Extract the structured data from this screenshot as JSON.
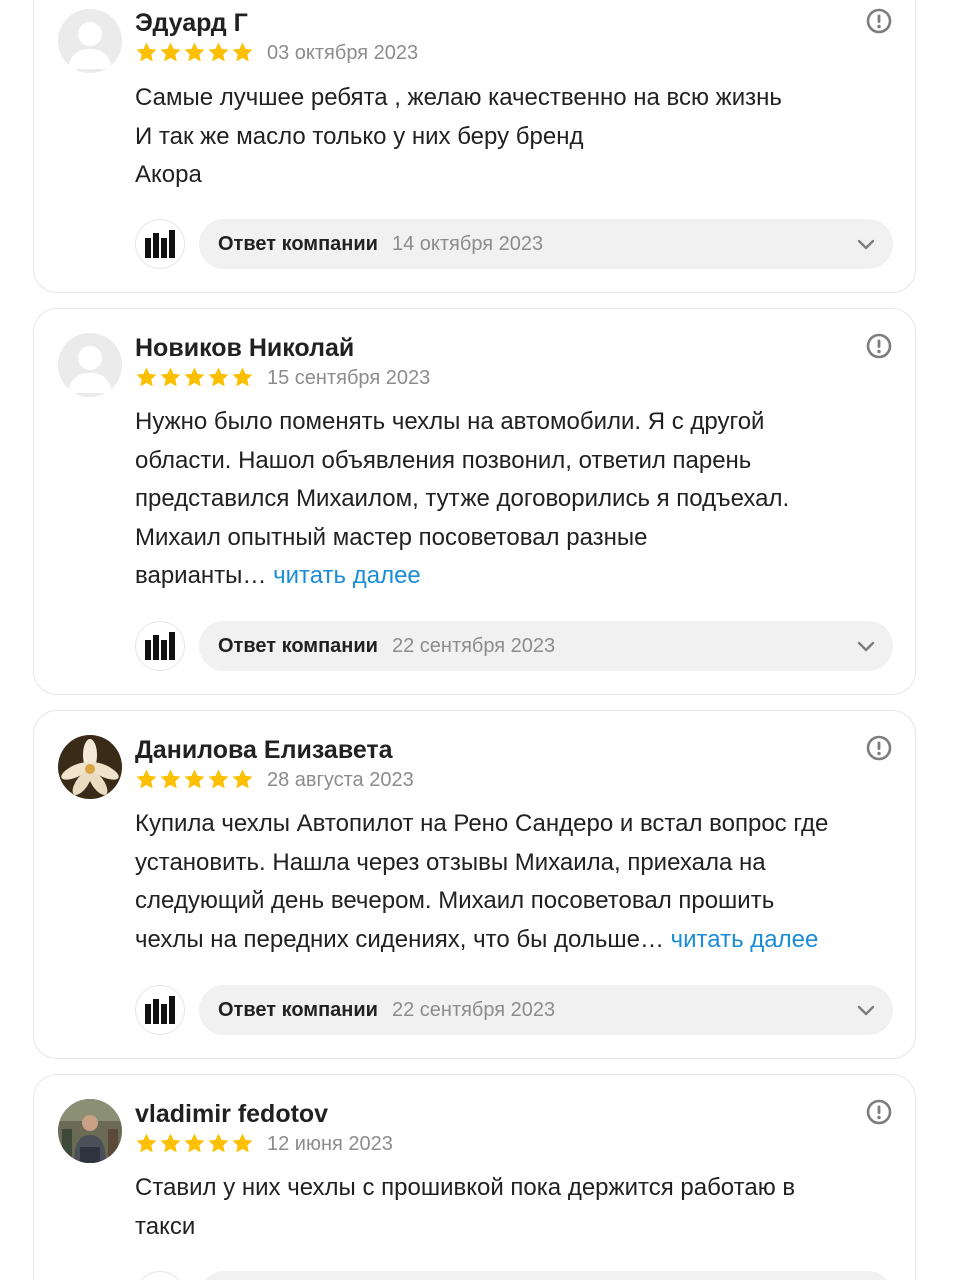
{
  "colors": {
    "star": "#fcc000",
    "link": "#1a8cd8",
    "muted": "#8c8c8c",
    "reply_bg": "#f1f1f1",
    "text": "#212121"
  },
  "icons": {
    "alert": "exclamation-circle-icon",
    "expand": "chevron-down-icon",
    "company": "company-logo-icon",
    "star": "star-icon"
  },
  "reviews": [
    {
      "author": "Эдуард Г",
      "rating": 5,
      "date": "03 октября 2023",
      "text_lines": [
        "Самые лучшее ребята , желаю качественно на всю жизнь",
        "И так же масло только у них беру бренд",
        "Акора"
      ],
      "read_more": "",
      "reply": {
        "label": "Ответ компании",
        "date": "14 октября 2023"
      }
    },
    {
      "author": "Новиков Николай",
      "rating": 5,
      "date": "15 сентября 2023",
      "text_lines": [
        "Нужно было поменять чехлы на автомобили. Я с другой",
        "области. Нашол объявления позвонил, ответил парень",
        "представился Михаилом, тутже договорились я подъехал.",
        "Михаил опытный мастер посоветовал разные",
        "варианты…"
      ],
      "read_more": "читать далее",
      "reply": {
        "label": "Ответ компании",
        "date": "22 сентября 2023"
      }
    },
    {
      "author": "Данилова Елизавета",
      "rating": 5,
      "date": "28 августа 2023",
      "text_lines": [
        "Купила чехлы Автопилот на Рено Сандеро и встал вопрос где",
        "установить. Нашла через отзывы Михаила, приехала на",
        "следующий день вечером. Михаил посоветовал прошить",
        "чехлы на передних сидениях, что бы дольше…"
      ],
      "read_more": "читать далее",
      "reply": {
        "label": "Ответ компании",
        "date": "22 сентября 2023"
      }
    },
    {
      "author": "vladimir fedotov",
      "rating": 5,
      "date": "12 июня 2023",
      "text_lines": [
        "Ставил у них чехлы с прошивкой пока держится работаю в",
        "такси"
      ],
      "read_more": "",
      "reply": {
        "label": "",
        "date": ""
      }
    }
  ]
}
